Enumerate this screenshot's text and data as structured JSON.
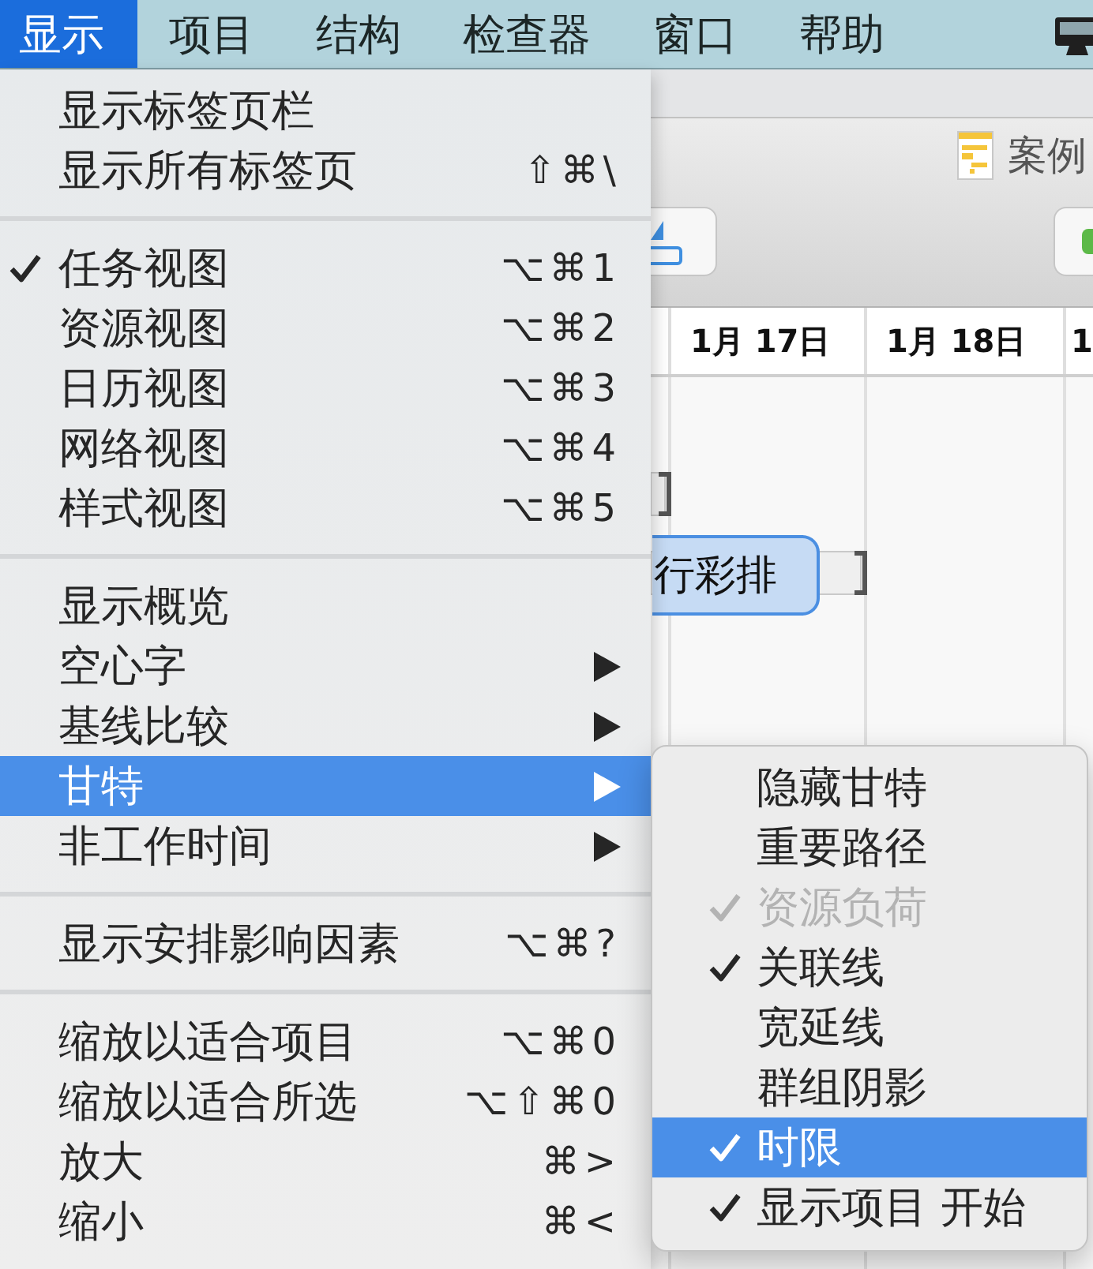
{
  "menu_bar": {
    "items": [
      {
        "label": "显示",
        "selected": true
      },
      {
        "label": "项目",
        "selected": false
      },
      {
        "label": "结构",
        "selected": false
      },
      {
        "label": "检查器",
        "selected": false
      },
      {
        "label": "窗口",
        "selected": false
      },
      {
        "label": "帮助",
        "selected": false
      }
    ]
  },
  "window": {
    "title": "案例"
  },
  "timeline": {
    "columns": [
      {
        "label": "1月 17日"
      },
      {
        "label": "1月 18日"
      },
      {
        "label": "1"
      }
    ],
    "items": [
      {
        "kind": "deadline"
      },
      {
        "kind": "deadline"
      },
      {
        "kind": "task",
        "label": "行彩排"
      }
    ]
  },
  "view_menu": {
    "groups": [
      {
        "items": [
          {
            "label": "显示标签页栏",
            "checked": false,
            "selected": false,
            "submenu": false
          },
          {
            "label": "显示所有标签页",
            "shortcut": "⇧⌘\\",
            "checked": false,
            "selected": false,
            "submenu": false
          }
        ]
      },
      {
        "items": [
          {
            "label": "任务视图",
            "shortcut": "⌥⌘1",
            "checked": true,
            "selected": false,
            "submenu": false
          },
          {
            "label": "资源视图",
            "shortcut": "⌥⌘2",
            "checked": false,
            "selected": false,
            "submenu": false
          },
          {
            "label": "日历视图",
            "shortcut": "⌥⌘3",
            "checked": false,
            "selected": false,
            "submenu": false
          },
          {
            "label": "网络视图",
            "shortcut": "⌥⌘4",
            "checked": false,
            "selected": false,
            "submenu": false
          },
          {
            "label": "样式视图",
            "shortcut": "⌥⌘5",
            "checked": false,
            "selected": false,
            "submenu": false
          }
        ]
      },
      {
        "items": [
          {
            "label": "显示概览",
            "checked": false,
            "selected": false,
            "submenu": false
          },
          {
            "label": "空心字",
            "checked": false,
            "selected": false,
            "submenu": true
          },
          {
            "label": "基线比较",
            "checked": false,
            "selected": false,
            "submenu": true
          },
          {
            "label": "甘特",
            "checked": false,
            "selected": true,
            "submenu": true
          },
          {
            "label": "非工作时间",
            "checked": false,
            "selected": false,
            "submenu": true
          }
        ]
      },
      {
        "items": [
          {
            "label": "显示安排影响因素",
            "shortcut": "⌥⌘?",
            "checked": false,
            "selected": false,
            "submenu": false
          }
        ]
      },
      {
        "items": [
          {
            "label": "缩放以适合项目",
            "shortcut": "⌥⌘0",
            "checked": false,
            "selected": false,
            "submenu": false
          },
          {
            "label": "缩放以适合所选",
            "shortcut": "⌥⇧⌘0",
            "checked": false,
            "selected": false,
            "submenu": false
          },
          {
            "label": "放大",
            "shortcut": "⌘>",
            "checked": false,
            "selected": false,
            "submenu": false
          },
          {
            "label": "缩小",
            "shortcut": "⌘<",
            "checked": false,
            "selected": false,
            "submenu": false
          }
        ]
      }
    ]
  },
  "gantt_submenu": {
    "items": [
      {
        "label": "隐藏甘特",
        "checked": false,
        "selected": false,
        "disabled": false
      },
      {
        "label": "重要路径",
        "checked": false,
        "selected": false,
        "disabled": false
      },
      {
        "label": "资源负荷",
        "checked": true,
        "selected": false,
        "disabled": true
      },
      {
        "label": "关联线",
        "checked": true,
        "selected": false,
        "disabled": false
      },
      {
        "label": "宽延线",
        "checked": false,
        "selected": false,
        "disabled": false
      },
      {
        "label": "群组阴影",
        "checked": false,
        "selected": false,
        "disabled": false
      },
      {
        "label": "时限",
        "checked": true,
        "selected": true,
        "disabled": false
      },
      {
        "label": "显示项目 开始",
        "checked": true,
        "selected": false,
        "disabled": false
      }
    ]
  }
}
